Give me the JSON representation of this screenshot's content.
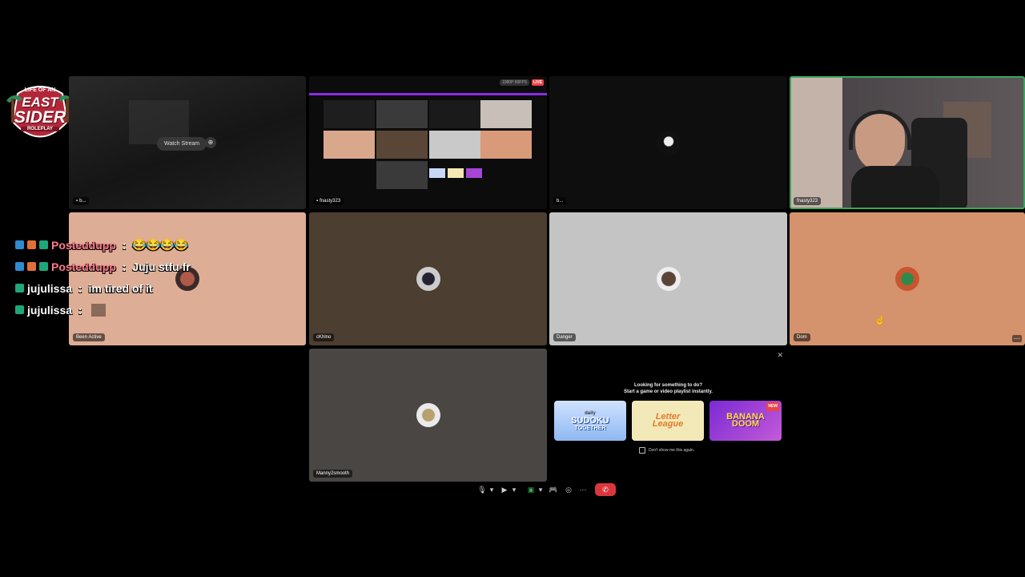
{
  "logo": {
    "line1": "LIFE OF AN",
    "line2": "EAST",
    "line3": "SIDER",
    "line4": "ROLEPLAY"
  },
  "colors": {
    "live": "#ed4245",
    "hangup": "#da373c",
    "speaking": "#3ba55d",
    "posteddupp_name": "#ff7a8a"
  },
  "chat": [
    {
      "badges": [
        "kick-icon",
        "vip-icon",
        "og-icon",
        "sub-icon"
      ],
      "user": "Posteddupp",
      "sep": " : ",
      "message": "😂😂😂😂"
    },
    {
      "badges": [
        "kick-icon",
        "vip-icon",
        "og-icon",
        "sub-icon"
      ],
      "user": "Posteddupp",
      "sep": " : ",
      "message": "Juju stfu fr"
    },
    {
      "badges": [
        "kick-icon",
        "sub-icon"
      ],
      "user": "jujulissa",
      "sep": " : ",
      "message": "im tired of it"
    },
    {
      "badges": [
        "kick-icon",
        "sub-icon"
      ],
      "user": "jujulissa",
      "sep": " : ",
      "message": ""
    }
  ],
  "tiles": {
    "t1": {
      "label": "b...",
      "watch": "Watch Stream"
    },
    "t2": {
      "label": "fnasty323",
      "live": "LIVE",
      "stream_title": "1080P 60FPS"
    },
    "t3": {
      "label": "b..."
    },
    "t4": {
      "label": "fnasty323"
    },
    "t5": {
      "label": "Been Active"
    },
    "t6": {
      "label": "cKhlno"
    },
    "t7": {
      "label": "Danger"
    },
    "t8": {
      "label": "Dom",
      "more": "⋯"
    },
    "t9": {
      "label": "Manny2smooth"
    }
  },
  "activity": {
    "line1": "Looking for something to do?",
    "line2": "Start a game or video playlist instantly.",
    "close": "✕",
    "cards": [
      {
        "small": "daily",
        "title": "SUDOKU",
        "sub": "TOGETHER"
      },
      {
        "small": "",
        "title": "Letter",
        "sub": "League"
      },
      {
        "small": "NEW",
        "title": "BANANA",
        "sub": "DOOM"
      }
    ],
    "checkbox": "Don't show me this again."
  },
  "controls": {
    "mic": "🎙",
    "caret": "▾",
    "camera": "▶",
    "screen": "▣",
    "activity": "🎮",
    "soundboard": "◎",
    "more": "⋯",
    "hangup": "✆"
  }
}
